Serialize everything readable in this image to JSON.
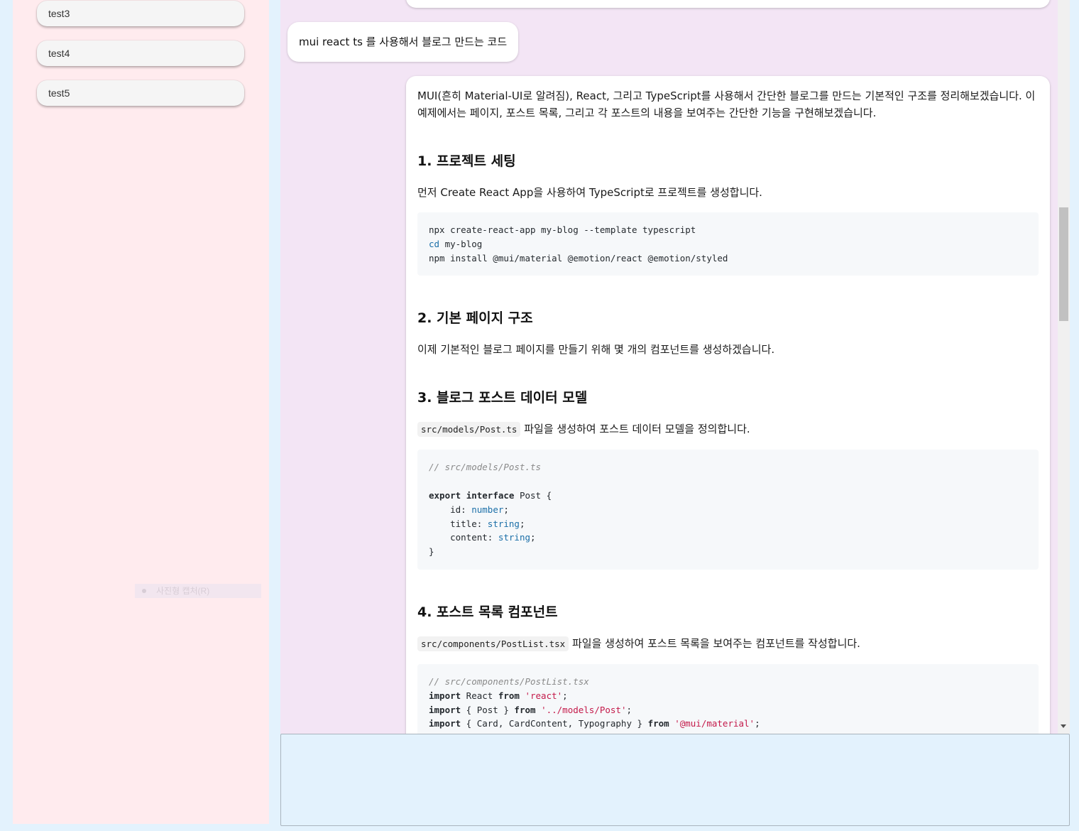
{
  "sidebar": {
    "items": [
      {
        "label": "test3"
      },
      {
        "label": "test4"
      },
      {
        "label": "test5"
      }
    ],
    "context_menu_hint": "사진형 캡처(R)"
  },
  "chat": {
    "user_message": "mui react ts 를 사용해서 블로그 만드는 코드",
    "answer": {
      "intro": "MUI(흔히 Material-UI로 알려짐), React, 그리고 TypeScript를 사용해서 간단한 블로그를 만드는 기본적인 구조를 정리해보겠습니다. 이 예제에서는 페이지, 포스트 목록, 그리고 각 포스트의 내용을 보여주는 간단한 기능을 구현해보겠습니다.",
      "sections": [
        {
          "heading": "1. 프로젝트 세팅",
          "desc": "먼저 Create React App을 사용하여 TypeScript로 프로젝트를 생성합니다."
        },
        {
          "heading": "2. 기본 페이지 구조",
          "desc": "이제 기본적인 블로그 페이지를 만들기 위해 몇 개의 컴포넌트를 생성하겠습니다."
        },
        {
          "heading": "3. 블로그 포스트 데이터 모델",
          "file": "src/models/Post.ts",
          "desc": " 파일을 생성하여 포스트 데이터 모델을 정의합니다."
        },
        {
          "heading": "4. 포스트 목록 컴포넌트",
          "file": "src/components/PostList.tsx",
          "desc": " 파일을 생성하여 포스트 목록을 보여주는 컴포넌트를 작성합니다."
        }
      ]
    }
  },
  "input": {
    "placeholder": ""
  },
  "colors": {
    "sidebar_bg": "#ffebee",
    "chat_bg": "#f3e5f5",
    "page_bg": "#e3f2fd",
    "code_bg": "#f6f8fa"
  }
}
